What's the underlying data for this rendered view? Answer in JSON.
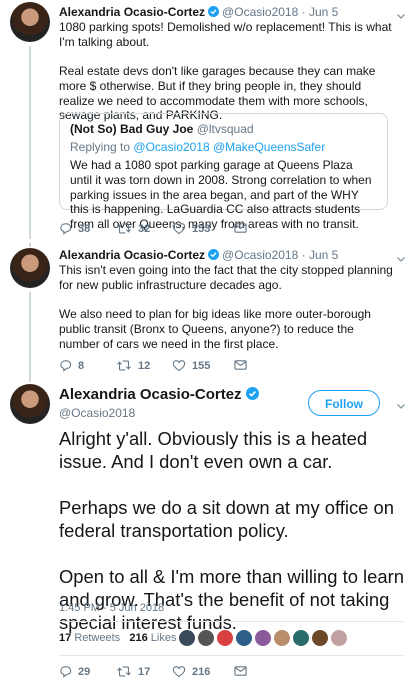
{
  "tweet1": {
    "name": "Alexandria Ocasio-Cortez",
    "handle": "@Ocasio2018",
    "date": "Jun 5",
    "text_p1": "1080 parking spots! Demolished w/o replacement! This is what I'm talking about.",
    "text_p2": "Real estate devs don't like garages because they can make more $ otherwise. But if they bring people in, they should realize we need to accommodate them with more schools, sewage plants, and PARKING.",
    "quote": {
      "name": "(Not So) Bad Guy Joe",
      "handle": "@ltvsquad",
      "replying_prefix": "Replying to",
      "replying_handles": "@Ocasio2018 @MakeQueensSafer",
      "text": "We had a 1080 spot parking garage at Queens Plaza until it was torn down in 2008. Strong correlation to when parking issues in the area began, and part of the WHY this is happening. LaGuardia CC also attracts students from all over Queens, many from areas with no transit."
    },
    "replies": "38",
    "retweets": "32",
    "likes": "153"
  },
  "tweet2": {
    "name": "Alexandria Ocasio-Cortez",
    "handle": "@Ocasio2018",
    "date": "Jun 5",
    "text_p1": "This isn't even going into the fact that the city stopped planning for new public infrastructure decades ago.",
    "text_p2": "We also need to plan for big ideas like more outer-borough public transit (Bronx to Queens, anyone?) to reduce the number of cars we need in the first place.",
    "replies": "8",
    "retweets": "12",
    "likes": "155"
  },
  "tweet3": {
    "name": "Alexandria Ocasio-Cortez",
    "handle": "@Ocasio2018",
    "follow_label": "Follow",
    "text_p1": "Alright y'all. Obviously this is a heated issue. And I don't even own a car.",
    "text_p2": "Perhaps we do a sit down at my office on federal transportation policy.",
    "text_p3": "Open to all & I'm more than willing to learn and grow. That's the benefit of not taking special interest funds.",
    "timestamp": "1:45 PM - 5 Jun 2018",
    "retweets_count": "17",
    "retweets_label": "Retweets",
    "likes_count": "216",
    "likes_label": "Likes",
    "replies": "29",
    "retweets": "17",
    "likes": "216"
  },
  "colors": {
    "accent": "#1da1f2",
    "muted": "#657786",
    "border": "#cfd9de"
  },
  "icons": [
    "verified-badge-icon",
    "reply-icon",
    "retweet-icon",
    "like-icon",
    "dm-icon",
    "chevron-down-icon"
  ]
}
